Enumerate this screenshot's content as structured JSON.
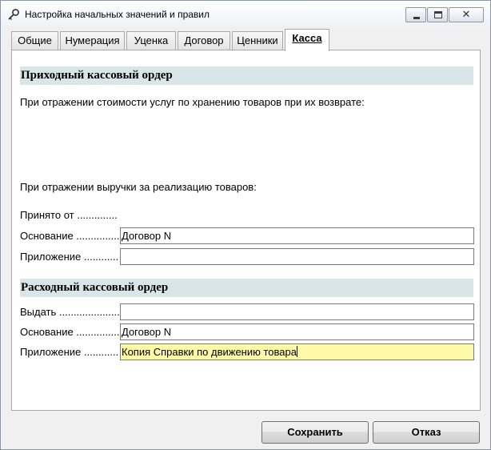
{
  "window": {
    "title": "Настройка начальных значений и правил"
  },
  "tabs": [
    {
      "label": "Общие"
    },
    {
      "label": "Нумерация"
    },
    {
      "label": "Уценка"
    },
    {
      "label": "Договор"
    },
    {
      "label": "Ценники"
    },
    {
      "label": "Касса",
      "active": true
    }
  ],
  "incoming": {
    "header": "Приходный кассовый ордер",
    "storage_text": "При отражении стоимости услуг по хранению товаров при их возврате:",
    "sales_text": "При отражении выручки за реализацию товаров:",
    "received_from_label": "Принято от ..............",
    "basis_label": "Основание ...............",
    "basis_value": "Договор N",
    "attachment_label": "Приложение ............",
    "attachment_value": ""
  },
  "outgoing": {
    "header": "Расходный кассовый ордер",
    "issue_label": "Выдать ......................",
    "issue_value": "",
    "basis_label": "Основание ...............",
    "basis_value": "Договор N",
    "attachment_label": "Приложение ............",
    "attachment_value": "Копия Справки по движению товара"
  },
  "buttons": {
    "save": "Сохранить",
    "cancel": "Отказ"
  },
  "icons": {
    "app": "key-icon",
    "minimize": "minimize-icon",
    "maximize": "maximize-icon",
    "close": "close-icon"
  }
}
